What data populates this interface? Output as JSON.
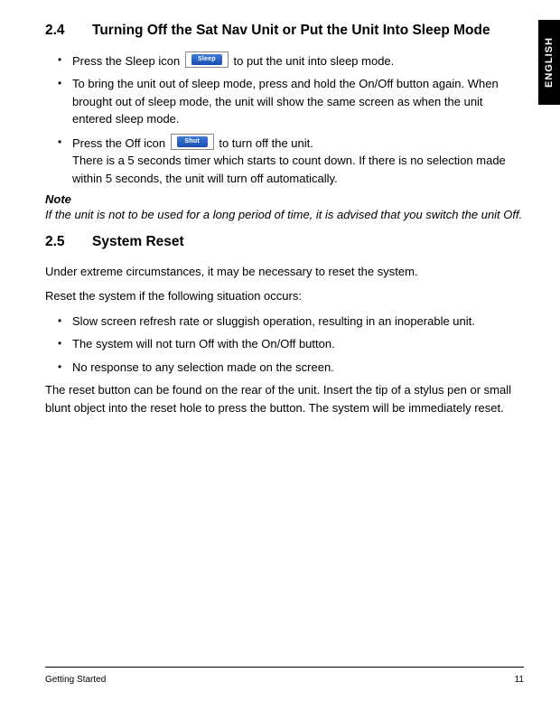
{
  "lang_tab": "ENGLISH",
  "section24": {
    "number": "2.4",
    "title": "Turning Off the Sat Nav Unit or Put the Unit Into Sleep Mode",
    "items": [
      {
        "pre": "Press the Sleep icon ",
        "icon": "Sleep",
        "post": " to put the unit into sleep mode."
      },
      {
        "full": "To bring the unit out of sleep mode, press and hold the On/Off button again. When brought out of sleep mode, the unit will show the same screen as when the unit entered sleep mode."
      },
      {
        "pre": "Press the Off icon ",
        "icon": "Shut",
        "post": " to turn off the unit.",
        "extra": "There is a 5 seconds timer which starts to count down. If there is no selection made within 5 seconds, the unit will turn off automatically."
      }
    ],
    "note_label": "Note",
    "note_text": "If the unit is not to be used for a long period of time, it is advised that you switch the unit Off."
  },
  "section25": {
    "number": "2.5",
    "title": "System Reset",
    "intro1": "Under extreme circumstances, it may be necessary to reset the system.",
    "intro2": "Reset the system if the following situation occurs:",
    "items": [
      "Slow screen refresh rate or sluggish operation, resulting in an inoperable unit.",
      "The system will not turn Off with the On/Off button.",
      "No response to any selection made on the screen."
    ],
    "tail": "The reset button can be found on the rear of the unit. Insert the tip of a stylus pen or small blunt object into the reset hole to press the button. The system will be immediately reset."
  },
  "footer": {
    "left": "Getting Started",
    "right": "11"
  }
}
